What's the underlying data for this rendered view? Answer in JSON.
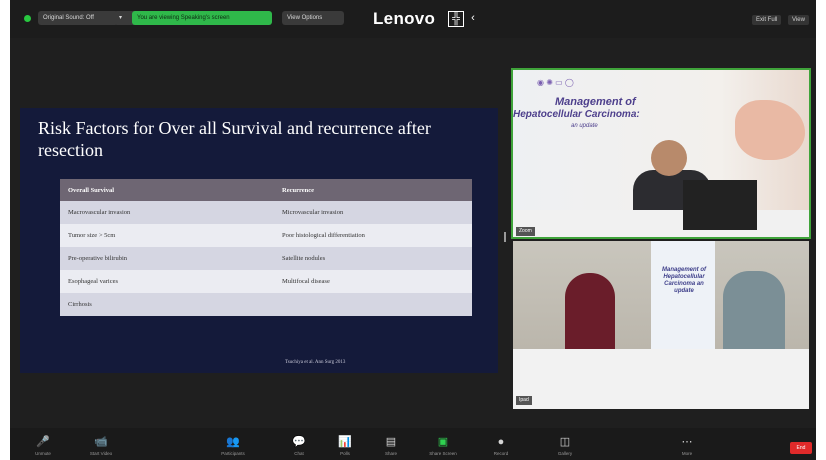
{
  "header": {
    "pill_left": "Original Sound: Off",
    "pill_green": "You are viewing Speaking's screen",
    "pill_view": "View Options",
    "brand": "Lenovo",
    "exit_btn": "Exit Full",
    "view_btn": "View"
  },
  "slide": {
    "title": "Risk Factors for Over all Survival and recurrence after resection",
    "table": {
      "headers": [
        "Overall Survival",
        "Recurrence"
      ],
      "rows": [
        [
          "Macrovascular invasion",
          "Microvascular invasion"
        ],
        [
          "Tumor size > 5cm",
          "Poor histological differentiation"
        ],
        [
          "Pre-operative bilirubin",
          "Satellite nodules"
        ],
        [
          "Esophageal varices",
          "Multifocal disease"
        ],
        [
          "Cirrhosis",
          ""
        ]
      ]
    },
    "footer": "Tsuchiya et al. Ann Surg 2013"
  },
  "video_speaker": {
    "banner_line1": "Management of",
    "banner_line2": "Hepatocellular Carcinoma:",
    "banner_line3": "an update",
    "name": "Zoom"
  },
  "video_room": {
    "rollup_text": "Management of Hepatocellular Carcinoma an update",
    "name": "Ipad"
  },
  "toolbar": {
    "items": [
      {
        "icon": "🎤",
        "label": "Unmute"
      },
      {
        "icon": "📹",
        "label": "Start Video"
      },
      {
        "icon": "👥",
        "label": "Participants"
      },
      {
        "icon": "💬",
        "label": "Chat"
      },
      {
        "icon": "📊",
        "label": "Polls"
      },
      {
        "icon": "▤",
        "label": "Share"
      },
      {
        "icon": "▣",
        "label": "Share Screen"
      },
      {
        "icon": "●",
        "label": "Record"
      },
      {
        "icon": "◫",
        "label": "Gallery"
      },
      {
        "icon": "⋯",
        "label": "More"
      }
    ],
    "end_label": "End"
  },
  "colors": {
    "green": "#2fb84a",
    "end": "#e02a2a",
    "slide_bg": "#141a3a"
  }
}
